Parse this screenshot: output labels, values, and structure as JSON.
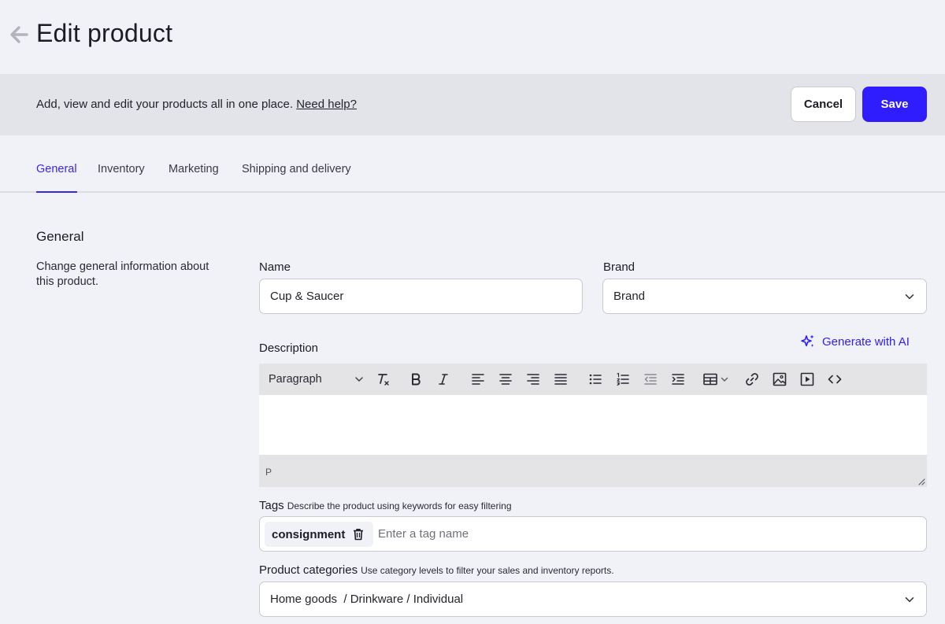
{
  "header": {
    "title": "Edit product",
    "back_icon": "arrow-left-icon"
  },
  "banner": {
    "text": "Add, view and edit your products all in one place.",
    "help_link": "Need help?",
    "cancel_label": "Cancel",
    "save_label": "Save"
  },
  "tabs": [
    {
      "label": "General",
      "active": true
    },
    {
      "label": "Inventory",
      "active": false
    },
    {
      "label": "Marketing",
      "active": false
    },
    {
      "label": "Shipping and delivery",
      "active": false
    }
  ],
  "general": {
    "title": "General",
    "description": "Change general information about this product.",
    "name_label": "Name",
    "name_value": "Cup & Saucer",
    "brand_label": "Brand",
    "brand_value": "Brand",
    "description_label": "Description",
    "generate_ai_label": "Generate with AI",
    "editor": {
      "block_format": "Paragraph",
      "toolbar_icons": [
        "clear-format-icon",
        "bold-icon",
        "italic-icon",
        "align-left-icon",
        "align-center-icon",
        "align-right-icon",
        "align-justify-icon",
        "bullet-list-icon",
        "numbered-list-icon",
        "outdent-icon",
        "indent-icon",
        "table-icon",
        "link-icon",
        "image-icon",
        "media-icon",
        "code-icon"
      ],
      "status_path": "P"
    },
    "tags_label": "Tags",
    "tags_hint": "Describe the product using keywords for easy filtering",
    "tags": [
      "consignment"
    ],
    "tag_placeholder": "Enter a tag name",
    "categories_label": "Product categories",
    "categories_hint": "Use category levels to filter your sales and inventory reports.",
    "categories_value": "Home goods  / Drinkware / Individual"
  },
  "colors": {
    "accent": "#2f1cff",
    "active_tab": "#3a26e8",
    "page_bg": "#f1f2f7",
    "banner_bg": "#e3e4e9"
  }
}
